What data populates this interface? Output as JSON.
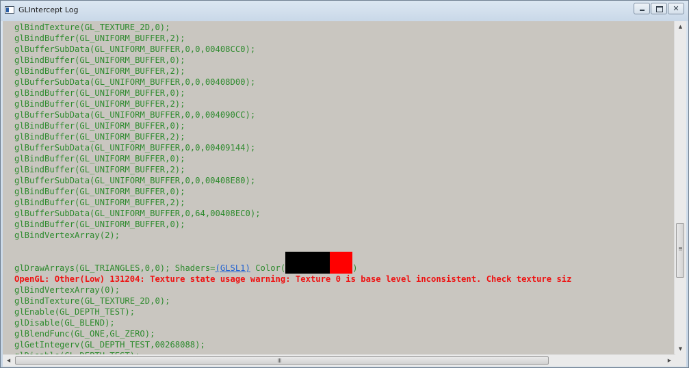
{
  "window": {
    "title": "GLIntercept Log",
    "close_glyph": "✕"
  },
  "icons": {
    "app": "app-window-icon",
    "minimize": "minimize-icon",
    "maximize": "maximize-icon",
    "close": "close-icon"
  },
  "colors": {
    "log_text": "#2d8a2d",
    "error_text": "#ee1111",
    "link": "#1c5fd1",
    "background": "#c9c6c0"
  },
  "log": {
    "lines_before": [
      "glBindTexture(GL_TEXTURE_2D,0);",
      "glBindTexture(GL_TEXTURE_2D,0);",
      "glBindBuffer(GL_UNIFORM_BUFFER,2);",
      "glBufferSubData(GL_UNIFORM_BUFFER,0,0,00408CC0);",
      "glBindBuffer(GL_UNIFORM_BUFFER,0);",
      "glBindBuffer(GL_UNIFORM_BUFFER,2);",
      "glBufferSubData(GL_UNIFORM_BUFFER,0,0,00408D00);",
      "glBindBuffer(GL_UNIFORM_BUFFER,0);",
      "glBindBuffer(GL_UNIFORM_BUFFER,2);",
      "glBufferSubData(GL_UNIFORM_BUFFER,0,0,004090CC);",
      "glBindBuffer(GL_UNIFORM_BUFFER,0);",
      "glBindBuffer(GL_UNIFORM_BUFFER,2);",
      "glBufferSubData(GL_UNIFORM_BUFFER,0,0,00409144);",
      "glBindBuffer(GL_UNIFORM_BUFFER,0);",
      "glBindBuffer(GL_UNIFORM_BUFFER,2);",
      "glBufferSubData(GL_UNIFORM_BUFFER,0,0,00408E80);",
      "glBindBuffer(GL_UNIFORM_BUFFER,0);",
      "glBindBuffer(GL_UNIFORM_BUFFER,2);",
      "glBufferSubData(GL_UNIFORM_BUFFER,0,64,00408EC0);",
      "glBindBuffer(GL_UNIFORM_BUFFER,0);",
      "glBindVertexArray(2);"
    ],
    "draw_call": {
      "prefix": "glDrawArrays(GL_TRIANGLES,0,0); Shaders=",
      "shader_link": "(GLSL1)",
      "color_label": " Color(",
      "color_suffix": ")",
      "color_swatches": [
        "#000000",
        "#ff0000"
      ]
    },
    "error_line": "OpenGL: Other(Low) 131204: Texture state usage warning: Texture 0 is base level inconsistent. Check texture siz",
    "lines_after": [
      "glBindVertexArray(0);",
      "glBindTexture(GL_TEXTURE_2D,0);",
      "glEnable(GL_DEPTH_TEST);",
      "glDisable(GL_BLEND);",
      "glBlendFunc(GL_ONE,GL_ZERO);",
      "glGetIntegerv(GL_DEPTH_TEST,00268088);",
      "glDisable(GL_DEPTH_TEST);"
    ]
  },
  "scrollbars": {
    "vertical_position_percent": 60,
    "horizontal_position_percent": 0,
    "grip": "≡",
    "hgrip": "|||"
  }
}
